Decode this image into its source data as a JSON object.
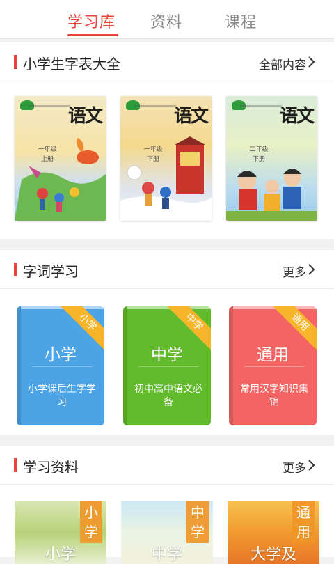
{
  "tabs": [
    {
      "label": "学习库",
      "active": true
    },
    {
      "label": "资料",
      "active": false
    },
    {
      "label": "课程",
      "active": false
    }
  ],
  "section_chars": {
    "title": "小学生字表大全",
    "more_label": "全部内容",
    "books": [
      {
        "title": "语文",
        "grade": "一年级",
        "volume": "上册"
      },
      {
        "title": "语文",
        "grade": "一年级",
        "volume": "下册"
      },
      {
        "title": "语文",
        "grade": "二年级",
        "volume": "下册"
      }
    ]
  },
  "section_words": {
    "title": "字词学习",
    "more_label": "更多",
    "books": [
      {
        "name": "小学",
        "tag": "小学",
        "desc": "小学课后生字学习",
        "color": "#4ca3e6"
      },
      {
        "name": "中学",
        "tag": "中学",
        "desc": "初中高中语文必备",
        "color": "#62bb2c"
      },
      {
        "name": "通用",
        "tag": "通用",
        "desc": "常用汉字知识集锦",
        "color": "#f46463"
      }
    ]
  },
  "section_materials": {
    "title": "学习资料",
    "more_label": "更多",
    "tiles": [
      {
        "tag": "小学",
        "text": "小学"
      },
      {
        "tag": "中学",
        "text": "中学"
      },
      {
        "tag": "通用",
        "text": "大学及"
      }
    ]
  },
  "colors": {
    "accent": "#e8443a",
    "ribbon": "#f7b52c"
  }
}
